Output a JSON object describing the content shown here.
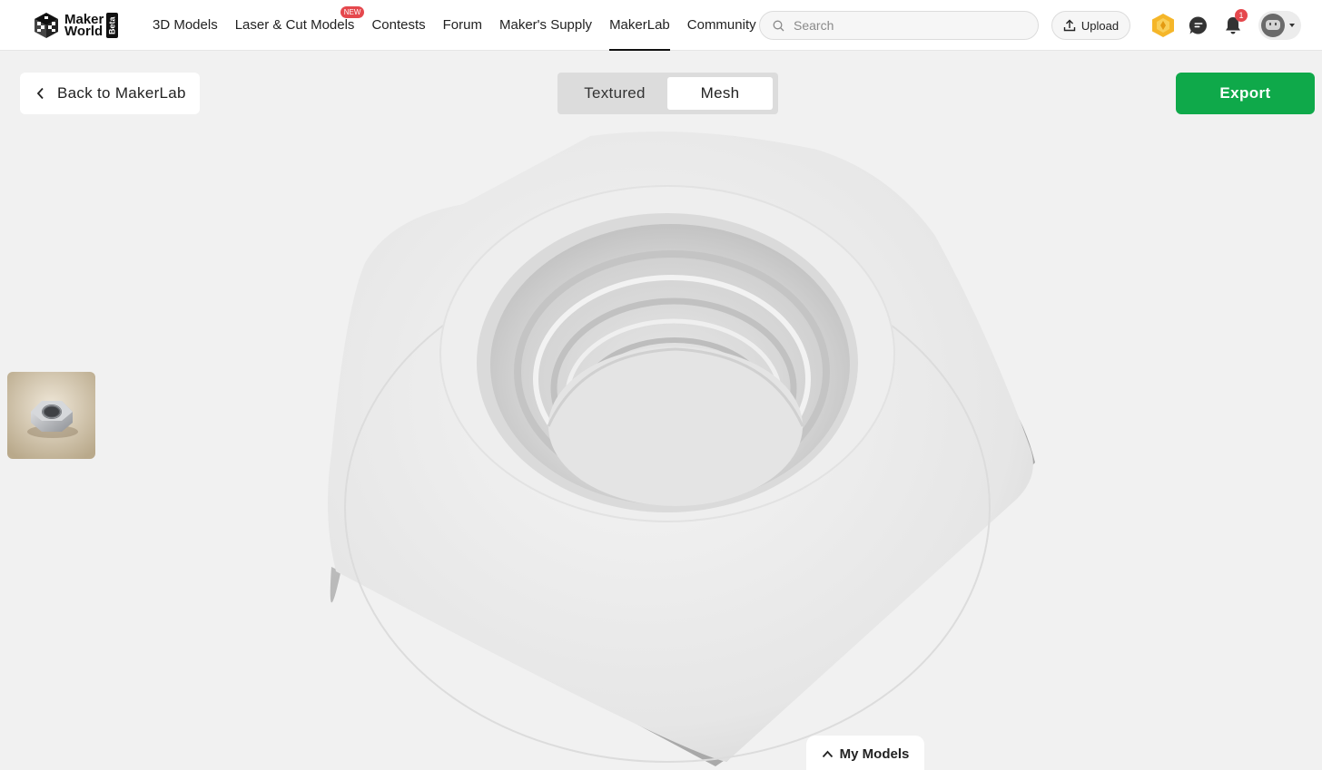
{
  "brand": {
    "name_line1": "Maker",
    "name_line2": "World",
    "beta": "Beta"
  },
  "nav": {
    "items": [
      {
        "label": "3D Models"
      },
      {
        "label": "Laser & Cut Models",
        "badge": "NEW"
      },
      {
        "label": "Contests"
      },
      {
        "label": "Forum"
      },
      {
        "label": "Maker's Supply"
      },
      {
        "label": "MakerLab",
        "active": true
      },
      {
        "label": "Community"
      }
    ]
  },
  "search": {
    "placeholder": "Search"
  },
  "header_actions": {
    "upload_label": "Upload",
    "notification_count": "1",
    "icons": [
      "points-hexagon-icon",
      "chat-bubble-icon",
      "bell-icon",
      "avatar"
    ]
  },
  "workspace": {
    "back_label": "Back to MakerLab",
    "view_toggle": {
      "options": [
        "Textured",
        "Mesh"
      ],
      "selected": "Mesh"
    },
    "export_label": "Export",
    "my_models_label": "My Models",
    "reference_image": "hex-nut-photo"
  },
  "colors": {
    "accent_green": "#0fa94a",
    "badge_red": "#e5484d",
    "canvas_bg": "#f1f1f1",
    "mesh_white": "#ececec"
  }
}
